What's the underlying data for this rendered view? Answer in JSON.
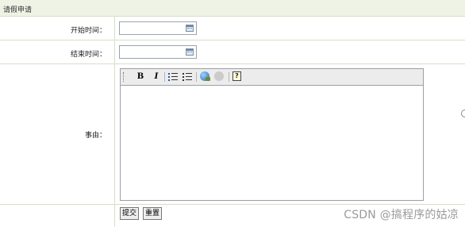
{
  "header": {
    "title": "请假申请"
  },
  "form": {
    "start_time": {
      "label": "开始时间：",
      "value": ""
    },
    "end_time": {
      "label": "结束时间：",
      "value": ""
    },
    "reason": {
      "label": "事由：",
      "value": ""
    }
  },
  "editor": {
    "toolbar": {
      "bold": "B",
      "italic": "I",
      "help": "?"
    }
  },
  "actions": {
    "submit": "提交",
    "reset": "重置"
  },
  "watermark": "CSDN @搞程序的姑凉",
  "icons": {
    "calendar": "calendar-icon",
    "ordered_list": "ordered-list-icon",
    "unordered_list": "unordered-list-icon",
    "link": "insert-link-icon",
    "unlink": "unlink-icon",
    "help": "help-icon"
  }
}
